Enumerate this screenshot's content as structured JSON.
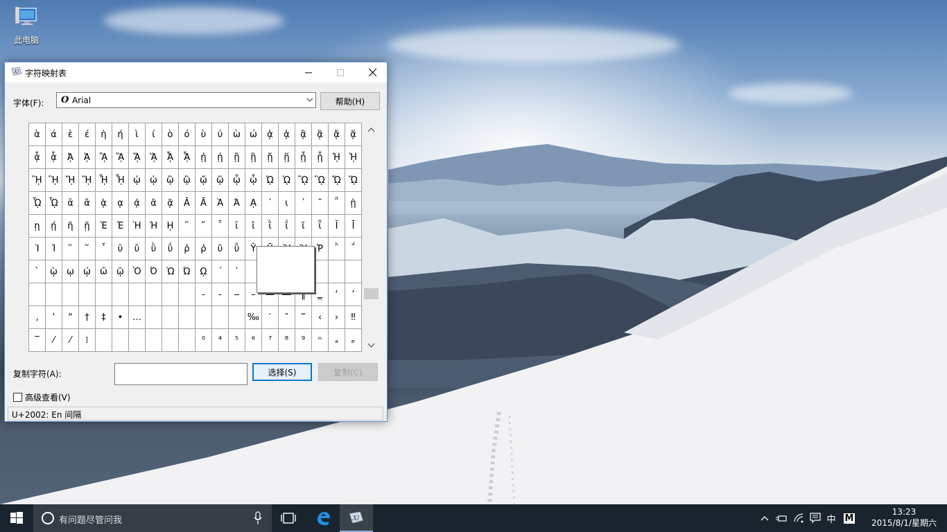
{
  "desktop": {
    "icons": [
      {
        "label": "此电脑",
        "icon": "computer-icon"
      }
    ]
  },
  "window": {
    "title": "字符映射表",
    "font_label": "字体(F):",
    "font_value": "Arial",
    "help_button": "帮助(H)",
    "characters": [
      [
        "ὰ",
        "ά",
        "ὲ",
        "έ",
        "ὴ",
        "ή",
        "ὶ",
        "ί",
        "ὸ",
        "ό",
        "ὺ",
        "ύ",
        "ὼ",
        "ώ",
        "ᾀ",
        "ᾁ",
        "ᾂ",
        "ᾃ",
        "ᾄ",
        "ᾅ"
      ],
      [
        "ᾆ",
        "ᾇ",
        "ᾈ",
        "ᾉ",
        "ᾊ",
        "ᾋ",
        "ᾌ",
        "ᾍ",
        "ᾎ",
        "ᾏ",
        "ᾐ",
        "ᾑ",
        "ᾒ",
        "ᾓ",
        "ᾔ",
        "ᾕ",
        "ᾖ",
        "ᾗ",
        "ᾘ",
        "ᾙ"
      ],
      [
        "ᾚ",
        "ᾛ",
        "ᾜ",
        "ᾝ",
        "ᾞ",
        "ᾟ",
        "ᾠ",
        "ᾡ",
        "ᾢ",
        "ᾣ",
        "ᾤ",
        "ᾥ",
        "ᾦ",
        "ᾧ",
        "ᾨ",
        "ᾩ",
        "ᾪ",
        "ᾫ",
        "ᾬ",
        "ᾭ"
      ],
      [
        "ᾮ",
        "ᾯ",
        "ᾰ",
        "ᾱ",
        "ᾲ",
        "ᾳ",
        "ᾴ",
        "ᾶ",
        "ᾷ",
        "Ᾰ",
        "Ᾱ",
        "Ὰ",
        "Ά",
        "ᾼ",
        "᾽",
        "ι",
        "᾿",
        "῀",
        "῁",
        "ῂ"
      ],
      [
        "ῃ",
        "ῄ",
        "ῆ",
        "ῇ",
        "Ὲ",
        "Έ",
        "Ὴ",
        "Ή",
        "ῌ",
        "῍",
        "῎",
        "῏",
        "ῐ",
        "ῑ",
        "ῒ",
        "ΐ",
        "ῖ",
        "ῗ",
        "Ῐ",
        "Ῑ"
      ],
      [
        "Ὶ",
        "Ί",
        "῝",
        "῞",
        "῟",
        "ῠ",
        "ῡ",
        "ῢ",
        "ΰ",
        "ῤ",
        "ῥ",
        "ῦ",
        "ῧ",
        "Ῠ",
        "Ῡ",
        "Ὺ",
        "Ύ",
        "Ῥ",
        "῭",
        "΅"
      ],
      [
        "`",
        "ῲ",
        "ῳ",
        "ῴ",
        "ῶ",
        "ῷ",
        "Ὸ",
        "Ό",
        "Ὼ",
        "Ώ",
        "ῼ",
        "´",
        "῾",
        "",
        "",
        "",
        "",
        "",
        "",
        ""
      ],
      [
        "",
        "",
        "",
        "",
        "",
        "",
        "",
        "",
        "",
        "",
        "‐",
        "‑",
        "‒",
        "–",
        "—",
        "―",
        "‖",
        "‗",
        "‘",
        "’"
      ],
      [
        "‚",
        "‛",
        "“",
        "†",
        "‡",
        "•",
        "…",
        "",
        "",
        "",
        "",
        "",
        "",
        "‰",
        "′",
        "″",
        "‴",
        "‹",
        "›",
        "‼"
      ],
      [
        "‾",
        "⁄",
        "⁄",
        "⁞",
        "",
        "",
        "",
        "",
        "",
        "",
        "⁰",
        "⁴",
        "⁵",
        "⁶",
        "⁷",
        "⁸",
        "⁹",
        "ⁿ",
        "ₐ",
        "ₑ"
      ]
    ],
    "copy_label": "复制字符(A):",
    "copy_value": "",
    "select_button": "选择(S)",
    "copy_button": "复制(C)",
    "advanced_label": "高级查看(V)",
    "advanced_checked": false,
    "status": "U+2002: En 间隔"
  },
  "taskbar": {
    "search_placeholder": "有问题尽管问我",
    "items": [
      "task-view-icon",
      "edge-icon",
      "charmap-icon"
    ],
    "tray": {
      "ime_label": "中",
      "ime_mode": "M",
      "time": "13:23",
      "date": "2015/8/1/星期六"
    }
  }
}
